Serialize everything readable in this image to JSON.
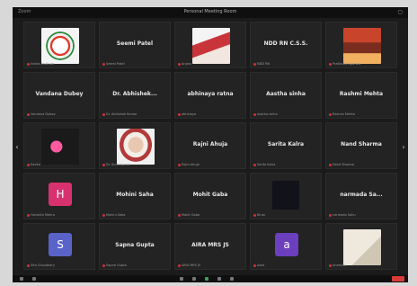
{
  "window": {
    "title": "Personal Meeting Room",
    "left_label": "Zoom",
    "right_icons": [
      "restore-icon"
    ]
  },
  "tiles": [
    {
      "id": "r1c1",
      "kind": "photo",
      "photo": "logo",
      "caption": "Indian Institute"
    },
    {
      "id": "r1c2",
      "kind": "name",
      "name": "Seemi Patel",
      "caption": "Seemi Patel"
    },
    {
      "id": "r1c3",
      "kind": "photo",
      "photo": "person-red",
      "caption": "Anjani"
    },
    {
      "id": "r1c4",
      "kind": "name",
      "name": "NDD RN C.S.S.",
      "caption": "NDD RN"
    },
    {
      "id": "r1c5",
      "kind": "photo",
      "photo": "scene",
      "caption": "Pratiksha Agarwal"
    },
    {
      "id": "r2c1",
      "kind": "name",
      "name": "Vandana Dubey",
      "caption": "Vandana Dubey"
    },
    {
      "id": "r2c2",
      "kind": "name",
      "name": "Dr. Abhishek...",
      "caption": "Dr. Abhishek Kumar"
    },
    {
      "id": "r2c3",
      "kind": "name",
      "name": "abhinaya ratna",
      "caption": "abhinaya"
    },
    {
      "id": "r2c4",
      "kind": "name",
      "name": "Aastha sinha",
      "caption": "Aastha sinha"
    },
    {
      "id": "r2c5",
      "kind": "name",
      "name": "Rashmi Mehta",
      "caption": "Rashmi Mehta"
    },
    {
      "id": "r3c1",
      "kind": "photo",
      "photo": "flowers",
      "caption": "Kavita"
    },
    {
      "id": "r3c2",
      "kind": "photo",
      "photo": "person-face",
      "caption": "Dr. Sunil Kumar"
    },
    {
      "id": "r3c3",
      "kind": "name",
      "name": "Rajni Ahuja",
      "caption": "Rajni Ahuja"
    },
    {
      "id": "r3c4",
      "kind": "name",
      "name": "Sarita Kalra",
      "caption": "Sarita Kalra"
    },
    {
      "id": "r3c5",
      "kind": "name",
      "name": "Nand Sharma",
      "caption": "Nand Sharma"
    },
    {
      "id": "r4c1",
      "kind": "avatar",
      "letter": "H",
      "color": "#d7326f",
      "caption": "Harshita Mehra"
    },
    {
      "id": "r4c2",
      "kind": "name",
      "name": "Mohini Saha",
      "caption": "Mohini Saha"
    },
    {
      "id": "r4c3",
      "kind": "name",
      "name": "Mohit Gaba",
      "caption": "Mohit Gaba"
    },
    {
      "id": "r4c4",
      "kind": "photo",
      "photo": "dark",
      "caption": "Kiran"
    },
    {
      "id": "r4c5",
      "kind": "name",
      "name": "narmada Sa...",
      "caption": "narmada Sahu"
    },
    {
      "id": "r5c1",
      "kind": "avatar",
      "letter": "S",
      "color": "#5a63c8",
      "caption": "Sita Choudhary"
    },
    {
      "id": "r5c2",
      "kind": "name",
      "name": "Sapna Gupta",
      "caption": "Sapna Gupta"
    },
    {
      "id": "r5c3",
      "kind": "name",
      "name": "AIRA MRS JS",
      "caption": "AIRA MRS JS"
    },
    {
      "id": "r5c4",
      "kind": "avatar",
      "letter": "a",
      "color": "#6b3fbd",
      "caption": "Aarti"
    },
    {
      "id": "r5c5",
      "kind": "photo",
      "photo": "sketch",
      "caption": "Anamika"
    }
  ],
  "nav": {
    "prev": "‹",
    "next": "›"
  }
}
